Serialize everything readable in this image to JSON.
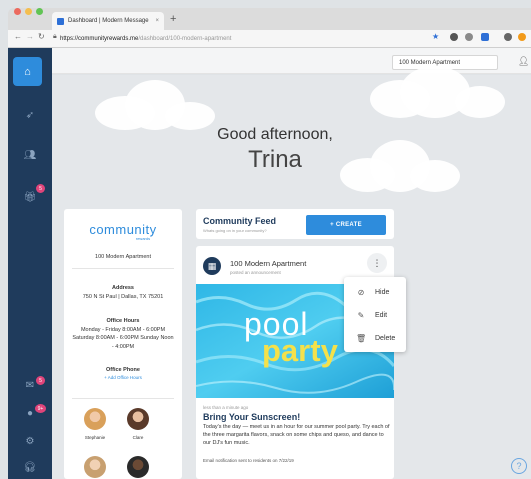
{
  "browser": {
    "tab_title": "Dashboard | Modern Message",
    "tab_close": "×",
    "new_tab": "+",
    "url_host": "https://communityrewards.me",
    "url_path": "/dashboard/100-modern-apartment"
  },
  "header": {
    "property_select": "100 Modern Apartment"
  },
  "sidebar": {
    "badges": [
      "5",
      "5",
      "9+"
    ]
  },
  "greeting": {
    "line1": "Good afternoon,",
    "line2": "Trina"
  },
  "property_card": {
    "logo_text": "community",
    "logo_sub": "rewards",
    "name": "100 Modern Apartment",
    "address_label": "Address",
    "address": "750 N St Paul | Dallas, TX 75201",
    "office_hours_label": "Office Hours",
    "office_hours": "Monday - Friday 8:00AM - 6:00PM Saturday 8:00AM - 6:00PM Sunday Noon - 4:00PM",
    "office_phone_label": "Office Phone",
    "add_office_hours": "+ Add Office Hours",
    "staff": [
      "Stephanie",
      "Clare"
    ]
  },
  "feed": {
    "title": "Community Feed",
    "subtitle": "Whats going on in your community?",
    "create_label": "+ CREATE"
  },
  "post": {
    "author": "100 Modern Apartment",
    "author_sub": "posted an announcement",
    "image_text1": "pool",
    "image_text2": "party",
    "time": "less than a minute ago",
    "title": "Bring Your Sunscreen!",
    "body": "Today's the day — meet us in an hour for our summer pool party. Try each of the three margarita flavors, snack on some chips and queso, and dance to our DJ's fun music.",
    "notification": "Email notification sent to residents on 7/22/19"
  },
  "context_menu": {
    "items": [
      "Hide",
      "Edit",
      "Delete"
    ]
  },
  "colors": {
    "sidebar": "#1f3b5c",
    "accent": "#2e8cdc",
    "badge": "#e0447a",
    "party": "#f4e14a"
  }
}
